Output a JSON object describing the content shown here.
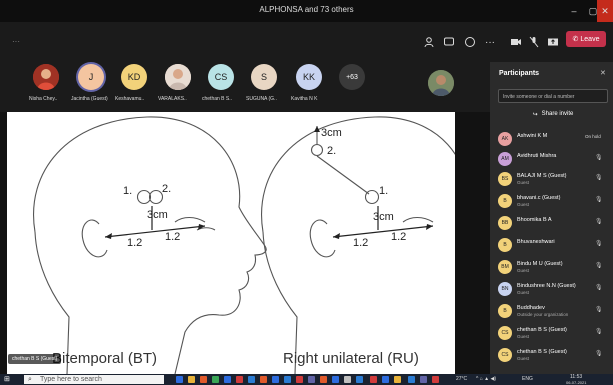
{
  "window": {
    "title": "ALPHONSA and 73 others"
  },
  "toolbar": {
    "leave_label": "Leave"
  },
  "participants_strip": [
    {
      "initials": "",
      "name": "Nisha Chey..",
      "color": "#c0392b"
    },
    {
      "initials": "J",
      "name": "Jacintha (Guest)",
      "color": "#f4c5a0",
      "selected": true
    },
    {
      "initials": "KD",
      "name": "Keshavamu..",
      "color": "#f2d27a"
    },
    {
      "initials": "",
      "name": "VARALAKS..",
      "color": "#e8d5c8"
    },
    {
      "initials": "CS",
      "name": "chethan B S..",
      "color": "#b9e3e6"
    },
    {
      "initials": "S",
      "name": "SUGUNA (G..",
      "color": "#e8d6c3"
    },
    {
      "initials": "KK",
      "name": "Kavitha N K",
      "color": "#c8d3f0"
    },
    {
      "initials": "+63",
      "name": "",
      "color": "#3a3a3a"
    }
  ],
  "slide": {
    "left_labels": {
      "p1": "1.",
      "p2": "2.",
      "dist": "3cm",
      "a": "1.2",
      "b": "1.2"
    },
    "right_labels": {
      "top_dist": "3cm",
      "p2": "2.",
      "p1": "1.",
      "dist": "3cm",
      "a": "1.2",
      "b": "1.2"
    },
    "caption_left": "Bitemporal (BT)",
    "caption_right": "Right unilateral (RU)"
  },
  "video_name_badge": "chethan B S (Guest)",
  "panel": {
    "title": "Participants",
    "invite_placeholder": "Invite someone or dial a number",
    "share_invite": "Share invite",
    "people": [
      {
        "initials": "AK",
        "name": "Ashwini K M",
        "sub": "",
        "status": "On hold",
        "color": "#e8a0a0"
      },
      {
        "initials": "AM",
        "name": "Avidhruti Mishra",
        "sub": "",
        "color": "#c9a0d8"
      },
      {
        "initials": "BS",
        "name": "BALAJI M S (Guest)",
        "sub": "Guest",
        "color": "#f2d27a"
      },
      {
        "initials": "B",
        "name": "bhavani.c (Guest)",
        "sub": "Guest",
        "color": "#f2d27a"
      },
      {
        "initials": "BB",
        "name": "Bhoomika B A",
        "sub": "",
        "color": "#f2d27a"
      },
      {
        "initials": "B",
        "name": "Bhuvaneshwari",
        "sub": "",
        "color": "#f2d27a"
      },
      {
        "initials": "BM",
        "name": "Bindu M U (Guest)",
        "sub": "Guest",
        "color": "#f2d27a"
      },
      {
        "initials": "BN",
        "name": "Bindushree N.N (Guest)",
        "sub": "Guest",
        "color": "#c8d3f0"
      },
      {
        "initials": "B",
        "name": "Buddhadev",
        "sub": "Outside your organization",
        "color": "#f2d27a"
      },
      {
        "initials": "CS",
        "name": "chethan B S (Guest)",
        "sub": "Guest",
        "color": "#f2d27a"
      },
      {
        "initials": "CS",
        "name": "chethan B S (Guest)",
        "sub": "Guest",
        "color": "#f2d27a"
      }
    ]
  },
  "taskbar": {
    "search_placeholder": "Type here to search",
    "weather": "27°C",
    "lang": "ENG",
    "time": "11:53",
    "date": "06-07-2021"
  }
}
